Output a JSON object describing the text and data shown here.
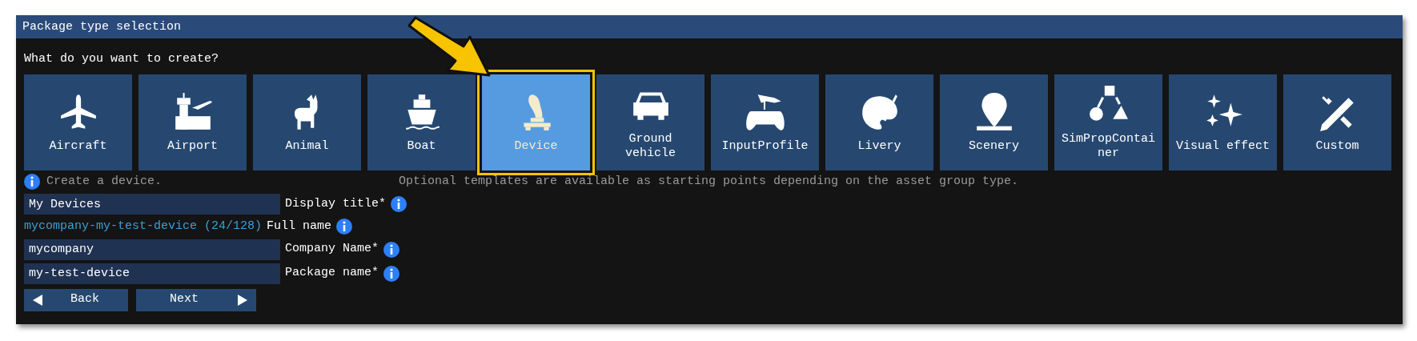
{
  "window": {
    "title": "Package type selection"
  },
  "prompt": "What do you want to create?",
  "tiles": [
    {
      "label": "Aircraft",
      "kind": "aircraft",
      "selected": false
    },
    {
      "label": "Airport",
      "kind": "airport",
      "selected": false
    },
    {
      "label": "Animal",
      "kind": "animal",
      "selected": false
    },
    {
      "label": "Boat",
      "kind": "boat",
      "selected": false
    },
    {
      "label": "Device",
      "kind": "device",
      "selected": true
    },
    {
      "label": "Ground vehicle",
      "kind": "car",
      "selected": false
    },
    {
      "label": "InputProfile",
      "kind": "gamepad",
      "selected": false
    },
    {
      "label": "Livery",
      "kind": "palette",
      "selected": false
    },
    {
      "label": "Scenery",
      "kind": "pin",
      "selected": false
    },
    {
      "label": "SimPropContainer",
      "kind": "shapes",
      "selected": false
    },
    {
      "label": "Visual effect",
      "kind": "sparkles",
      "selected": false
    },
    {
      "label": "Custom",
      "kind": "tools",
      "selected": false
    }
  ],
  "description": "Create a device.",
  "templates_note": "Optional templates are available as starting points depending on the asset group type.",
  "fields": [
    {
      "kind": "input",
      "value": "My Devices",
      "label": "Display title*"
    },
    {
      "kind": "computed",
      "value": "mycompany-my-test-device (24/128)",
      "label": "Full name"
    },
    {
      "kind": "input",
      "value": "mycompany",
      "label": "Company Name*"
    },
    {
      "kind": "input",
      "value": "my-test-device",
      "label": "Package name*"
    }
  ],
  "buttons": [
    {
      "label": "Back",
      "kind": "back"
    },
    {
      "label": "Next",
      "kind": "next"
    }
  ]
}
